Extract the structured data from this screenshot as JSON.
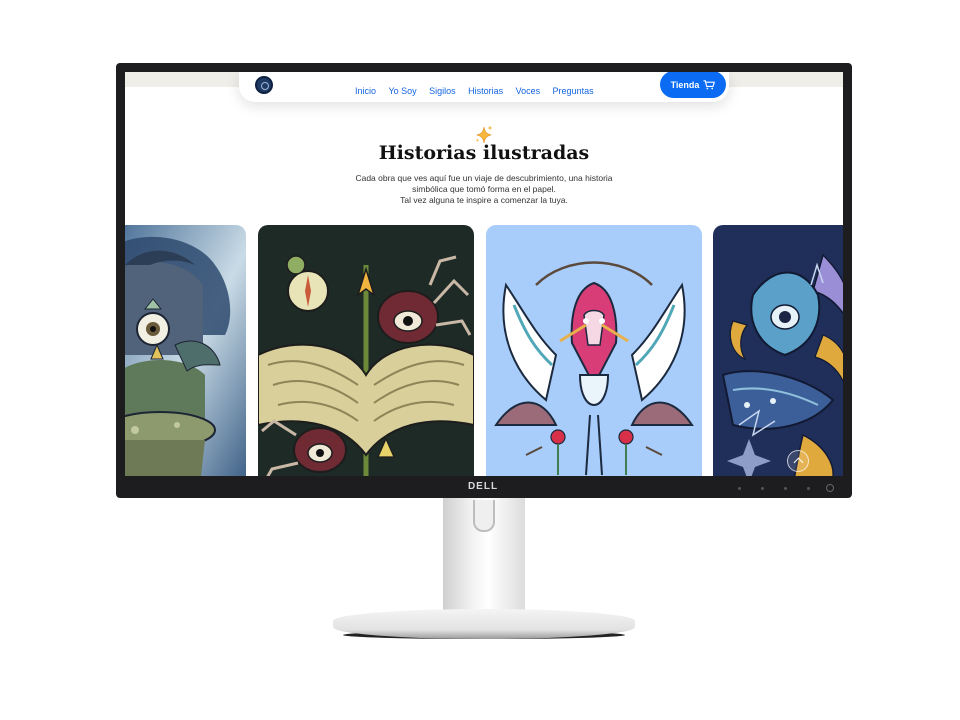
{
  "monitor": {
    "brand": "DELL"
  },
  "nav": {
    "links": [
      "Inicio",
      "Yo Soy",
      "Sigilos",
      "Historias",
      "Voces",
      "Preguntas"
    ],
    "shop_label": "Tienda",
    "accent": "#0b6cf3"
  },
  "section": {
    "title": "Historias ilustradas",
    "intro_lines": [
      "Cada obra que ves aquí fue un viaje de descubrimiento, una historia",
      "simbólica que tomó forma en el papel.",
      "Tal vez alguna te inspire a comenzar la tuya."
    ]
  },
  "gallery": {
    "cards": [
      {
        "subject": "owl-wizard",
        "background": "#2e4a6e"
      },
      {
        "subject": "spiders-and-wings",
        "background": "#1f2a26"
      },
      {
        "subject": "twin-herons",
        "background": "#a9cdfa"
      },
      {
        "subject": "eye-fish",
        "background": "#1f2f5a"
      }
    ]
  },
  "icons": {
    "sparkle": "sparkle-icon",
    "cart": "cart-icon",
    "scroll_top": "chevron-up-icon"
  }
}
